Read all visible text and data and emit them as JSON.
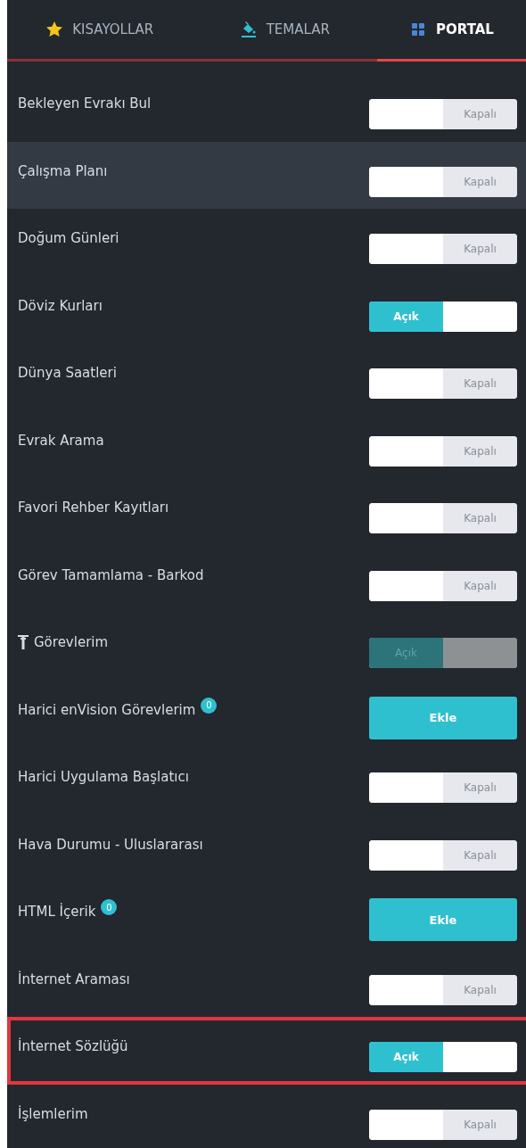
{
  "tabs": [
    {
      "label": "KISAYOLLAR",
      "selected": false
    },
    {
      "label": "TEMALAR",
      "selected": false
    },
    {
      "label": "PORTAL",
      "selected": true
    }
  ],
  "items": [
    {
      "label": "Bekleyen Evrakı Bul",
      "kind": "toggle",
      "on": false,
      "toggle_text": "Kapalı",
      "hovered": false,
      "outlined": false
    },
    {
      "label": "Çalışma Planı",
      "kind": "toggle",
      "on": false,
      "toggle_text": "Kapalı",
      "hovered": true,
      "outlined": false
    },
    {
      "label": "Doğum Günleri",
      "kind": "toggle",
      "on": false,
      "toggle_text": "Kapalı",
      "hovered": false,
      "outlined": false
    },
    {
      "label": "Döviz Kurları",
      "kind": "toggle",
      "on": true,
      "toggle_text": "Açık",
      "hovered": false,
      "outlined": false
    },
    {
      "label": "Dünya Saatleri",
      "kind": "toggle",
      "on": false,
      "toggle_text": "Kapalı",
      "hovered": false,
      "outlined": false
    },
    {
      "label": "Evrak Arama",
      "kind": "toggle",
      "on": false,
      "toggle_text": "Kapalı",
      "hovered": false,
      "outlined": false
    },
    {
      "label": "Favori Rehber Kayıtları",
      "kind": "toggle",
      "on": false,
      "toggle_text": "Kapalı",
      "hovered": false,
      "outlined": false
    },
    {
      "label": "Görev Tamamlama - Barkod",
      "kind": "toggle",
      "on": false,
      "toggle_text": "Kapalı",
      "hovered": false,
      "outlined": false
    },
    {
      "label": "Görevlerim",
      "kind": "toggle",
      "pinned": true,
      "disabled": true,
      "on": true,
      "toggle_text": "Açık",
      "hovered": false,
      "outlined": false
    },
    {
      "label": "Harici enVision Görevlerim",
      "kind": "add",
      "badge": "0",
      "button": "Ekle",
      "hovered": false,
      "outlined": false
    },
    {
      "label": "Harici Uygulama Başlatıcı",
      "kind": "toggle",
      "on": false,
      "toggle_text": "Kapalı",
      "hovered": false,
      "outlined": false
    },
    {
      "label": "Hava Durumu - Uluslararası",
      "kind": "toggle",
      "on": false,
      "toggle_text": "Kapalı",
      "hovered": false,
      "outlined": false
    },
    {
      "label": "HTML İçerik",
      "kind": "add",
      "badge": "0",
      "button": "Ekle",
      "hovered": false,
      "outlined": false
    },
    {
      "label": "İnternet Araması",
      "kind": "toggle",
      "on": false,
      "toggle_text": "Kapalı",
      "hovered": false,
      "outlined": false
    },
    {
      "label": "İnternet Sözlüğü",
      "kind": "toggle",
      "on": true,
      "toggle_text": "Açık",
      "hovered": false,
      "outlined": true
    },
    {
      "label": "İşlemlerim",
      "kind": "toggle",
      "on": false,
      "toggle_text": "Kapalı",
      "hovered": false,
      "outlined": false
    }
  ]
}
